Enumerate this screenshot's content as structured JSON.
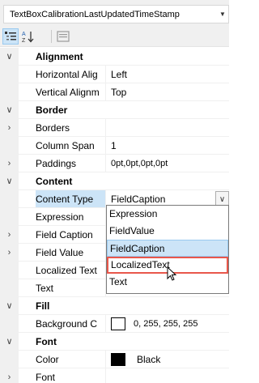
{
  "selector": {
    "value": "TextBoxCalibrationLastUpdatedTimeStamp",
    "arrow_icon": "dropdown-arrow-icon"
  },
  "toolbar": {
    "buttons": [
      "categorized-icon",
      "alphabetical-icon",
      "property-pages-icon"
    ]
  },
  "grid": {
    "alignment": {
      "label": "Alignment",
      "horizontal_name": "Horizontal Alig",
      "horizontal_value": "Left",
      "vertical_name": "Vertical Alignm",
      "vertical_value": "Top"
    },
    "border": {
      "label": "Border",
      "borders_name": "Borders",
      "borders_value": "",
      "column_span_name": "Column Span",
      "column_span_value": "1",
      "paddings_name": "Paddings",
      "paddings_value": "0pt,0pt,0pt,0pt"
    },
    "content": {
      "label": "Content",
      "content_type_name": "Content Type",
      "content_type_value": "FieldCaption",
      "expression_name": "Expression",
      "field_caption_name": "Field Caption",
      "field_value_name": "Field Value",
      "localized_text_name": "Localized Text",
      "text_name": "Text"
    },
    "fill": {
      "label": "Fill",
      "background_name": "Background C",
      "background_value": "0, 255, 255, 255"
    },
    "font": {
      "label": "Font",
      "color_name": "Color",
      "color_value": "Black",
      "font_name": "Font"
    }
  },
  "dropdown": {
    "options": [
      "Expression",
      "FieldValue",
      "FieldCaption",
      "LocalizedText",
      "Text"
    ],
    "hover_index": 2,
    "focused_index": 3
  },
  "colors": {
    "selection": "#cce4f7",
    "focus_border": "#e8574b",
    "gutter": "#f0f0f0"
  }
}
